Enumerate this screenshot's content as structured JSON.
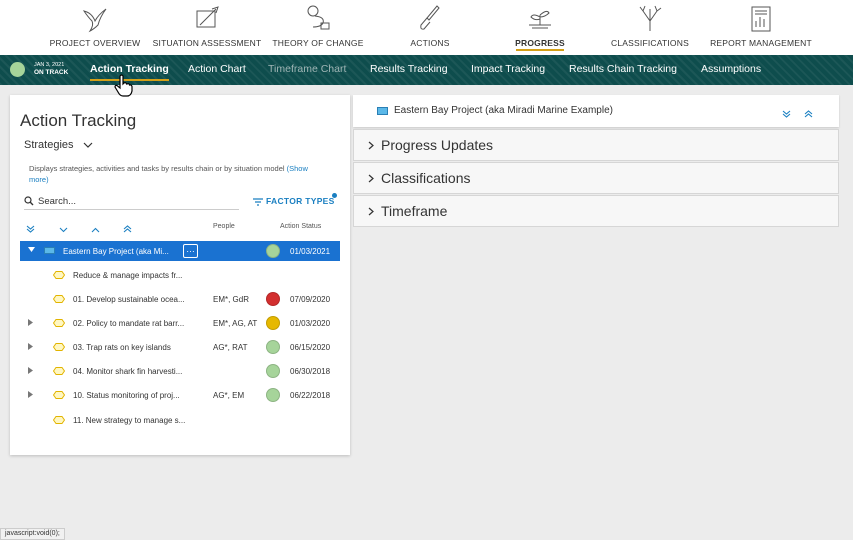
{
  "topnav": {
    "items": [
      {
        "label": "PROJECT OVERVIEW",
        "icon": "bird-icon"
      },
      {
        "label": "SITUATION ASSESSMENT",
        "icon": "map-pencil-icon"
      },
      {
        "label": "THEORY OF CHANGE",
        "icon": "flow-icon"
      },
      {
        "label": "ACTIONS",
        "icon": "shovel-icon"
      },
      {
        "label": "PROGRESS",
        "icon": "sprout-icon",
        "active": true
      },
      {
        "label": "CLASSIFICATIONS",
        "icon": "branch-icon"
      },
      {
        "label": "REPORT MANAGEMENT",
        "icon": "report-icon"
      }
    ]
  },
  "subnav": {
    "date": "JAN 3, 2021",
    "status": "ON TRACK",
    "status_color": "#a6d49a",
    "tabs": [
      {
        "label": "Action Tracking",
        "active": true
      },
      {
        "label": "Action Chart"
      },
      {
        "label": "Timeframe Chart",
        "dim": true
      },
      {
        "label": "Results Tracking"
      },
      {
        "label": "Impact Tracking"
      },
      {
        "label": "Results Chain Tracking"
      },
      {
        "label": "Assumptions"
      }
    ]
  },
  "left": {
    "title": "Action Tracking",
    "dropdown": "Strategies",
    "description": "Displays strategies, activities and tasks by results chain or by situation model",
    "show_more": "(Show more)",
    "search_placeholder": "Search...",
    "factor_types": "FACTOR TYPES",
    "col_people": "People",
    "col_status": "Action Status",
    "rows": [
      {
        "name": "Eastern Bay Project (aka Mi...",
        "people": "",
        "status": "#a6d49a",
        "date": "01/03/2021",
        "selected": true
      },
      {
        "name": "Reduce & manage impacts fr...",
        "people": "",
        "status": "",
        "date": ""
      },
      {
        "name": "01. Develop sustainable ocea...",
        "people": "EM*, GdR",
        "status": "#d32f2f",
        "date": "07/09/2020"
      },
      {
        "name": "02. Policy to mandate rat barr...",
        "people": "EM*, AG, AT",
        "status": "#e6b800",
        "date": "01/03/2020",
        "expandable": true
      },
      {
        "name": "03. Trap rats on key islands",
        "people": "AG*, RAT",
        "status": "#a6d49a",
        "date": "06/15/2020",
        "expandable": true
      },
      {
        "name": "04. Monitor shark fin harvesti...",
        "people": "",
        "status": "#a6d49a",
        "date": "06/30/2018",
        "expandable": true
      },
      {
        "name": "10. Status monitoring of proj...",
        "people": "AG*, EM",
        "status": "#a6d49a",
        "date": "06/22/2018",
        "expandable": true
      },
      {
        "name": "11. New strategy to manage s...",
        "people": "",
        "status": "",
        "date": ""
      }
    ]
  },
  "right": {
    "title": "Eastern Bay Project (aka Miradi Marine Example)",
    "sections": [
      "Progress Updates",
      "Classifications",
      "Timeframe"
    ]
  },
  "statusbar": "javascript:void(0);",
  "colors": {
    "accent": "#1a72d1",
    "link": "#1a7fc1",
    "subnav": "#0e4d4d",
    "underline": "#d4a017"
  }
}
